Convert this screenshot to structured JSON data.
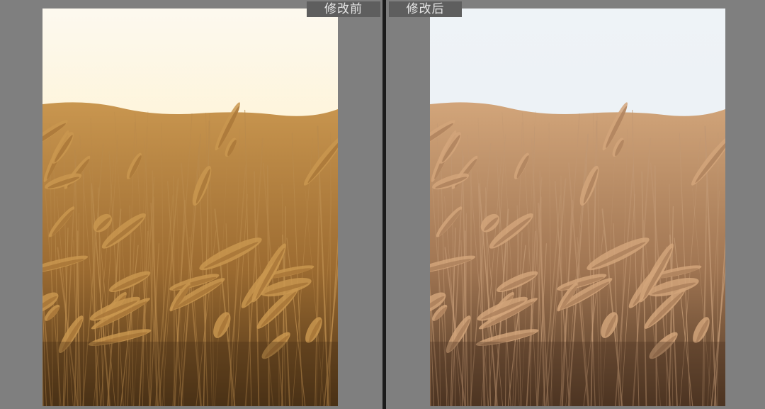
{
  "panes": {
    "before": {
      "label": "修改前",
      "sky_top": "#fdf9ef",
      "sky_glow": "#ffe9a8",
      "field_light": "#c9964f",
      "field_mid": "#9c6b31",
      "field_dark": "#4a3216",
      "stalk": "#b98a4c"
    },
    "after": {
      "label": "修改后",
      "sky_top": "#eef3f7",
      "sky_glow": "#e9eef2",
      "field_light": "#d2a57a",
      "field_mid": "#a07552",
      "field_dark": "#4c3522",
      "stalk": "#c19873"
    }
  },
  "colors": {
    "background": "#7f7f7f",
    "divider": "#1b1b1b",
    "label_bg": "#5e5e5e",
    "label_text": "#e8e8e8"
  }
}
